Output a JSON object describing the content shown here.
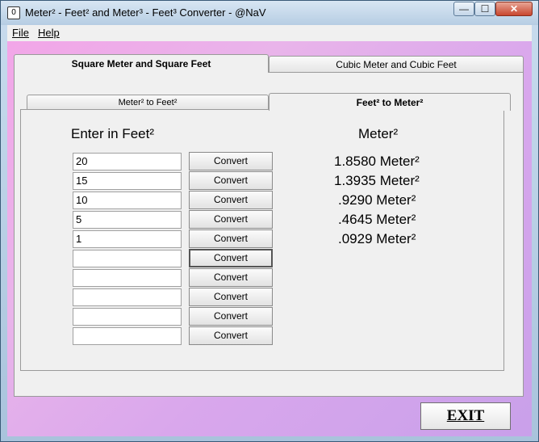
{
  "window": {
    "title": "Meter² - Feet² and Meter³ - Feet³ Converter - @NaV",
    "icon": "app-icon",
    "controls": {
      "minimize": "—",
      "maximize": "☐",
      "close": "✕"
    }
  },
  "menu": {
    "file": "File",
    "help": "Help"
  },
  "outer_tabs": {
    "active": "Square Meter and Square Feet",
    "inactive": "Cubic Meter and Cubic Feet"
  },
  "inner_tabs": {
    "inactive": "Meter² to Feet²",
    "active": "Feet² to Meter²"
  },
  "left_heading": "Enter in Feet²",
  "right_heading": "Meter²",
  "inputs": [
    "20",
    "15",
    "10",
    "5",
    "1",
    "",
    "",
    "",
    "",
    ""
  ],
  "convert_label": "Convert",
  "results": [
    "1.8580 Meter²",
    "1.3935 Meter²",
    ".9290 Meter²",
    ".4645 Meter²",
    ".0929 Meter²"
  ],
  "exit_label": "EXIT"
}
